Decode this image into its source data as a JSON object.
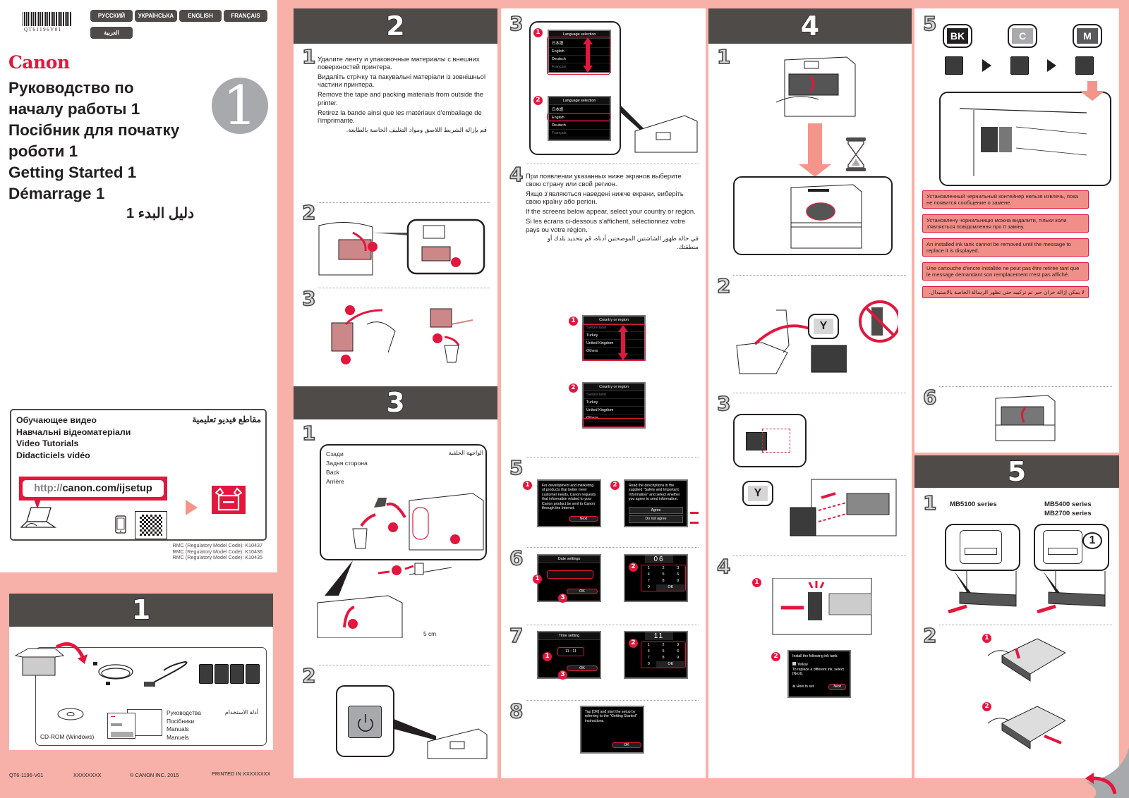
{
  "header": {
    "barcode_code": "QT61196V01",
    "languages": [
      "РУССКИЙ",
      "УКРАЇНСЬКА",
      "ENGLISH",
      "FRANÇAIS",
      "العربية"
    ],
    "brand": "Canon",
    "titles": [
      "Руководство по",
      "началу работы 1",
      "Посібник для початку",
      "роботи 1",
      "Getting Started 1",
      "Démarrage 1"
    ],
    "title_ar": "دليل البدء 1",
    "sheet_number": "1",
    "brand_color": "#e3173e",
    "accent_pink": "#f7b1a9",
    "bar_color": "#4e4b48"
  },
  "video": {
    "lines": [
      "Обучающее видео",
      "Навчальні відеоматеріали",
      "Video Tutorials",
      "Didacticiels vidéo"
    ],
    "title_ar": "مقاطع فيديو تعليمية",
    "url_prefix": "http://",
    "url_main": "canon.com/ijsetup"
  },
  "rmc": [
    "RMC (Regulatory Model Code): K10437",
    "RMC (Regulatory Model Code): K10436",
    "RMC (Regulatory Model Code): K10435"
  ],
  "section1": {
    "number": "1",
    "cdrom_label": "CD-ROM (Windows)",
    "manuals": [
      "Руководства",
      "Посібники",
      "Manuals",
      "Manuels"
    ],
    "manuals_ar": "أدلة الاستخدام"
  },
  "footer": {
    "code": "QT6-1196-V01",
    "placeholder": "XXXXXXXX",
    "copyright": "© CANON INC. 2015",
    "printed": "PRINTED IN XXXXXXXX"
  },
  "section2": {
    "number": "2",
    "step1": {
      "num": "1",
      "text": [
        "Удалите ленту и упаковочные материалы с внешних поверхностей принтера.",
        "Видаліть стрічку та пакувальні матеріали із зовнішньої частини принтера.",
        "Remove the tape and packing materials from outside the printer.",
        "Retirez la bande ainsi que les matériaux d'emballage de l'imprimante."
      ],
      "text_ar": "قم بإزالة الشريط اللاصق ومواد التغليف الخاصة بالطابعة."
    },
    "step2": {
      "num": "2"
    },
    "step3": {
      "num": "3"
    }
  },
  "section3": {
    "number": "3",
    "step1": {
      "num": "1",
      "back_labels": [
        "Сзади",
        "Задня сторона",
        "Back",
        "Arrière"
      ],
      "back_ar": "الواجهة الخلفية",
      "distance": "5 cm"
    },
    "step2": {
      "num": "2"
    },
    "step3": {
      "num": "3",
      "screen_title": "Language selection",
      "languages": [
        "日本語",
        "English",
        "Deutsch",
        "Français"
      ]
    },
    "step4": {
      "num": "4",
      "text": [
        "При появлении указанных ниже экранов выберите свою страну или свой регион.",
        "Якщо з'являються наведені нижче екрани, виберіть свою країну або регіон.",
        "If the screens below appear, select your country or region.",
        "Si les écrans ci-dessous s'affichent, sélectionnez votre pays ou votre région."
      ],
      "text_ar": "في حالة ظهور الشاشتين الموضحتين أدناه، قم بتحديد بلدك أو منطقتك.",
      "screen_title": "Country or region",
      "countries": [
        "Switzerland",
        "Turkey",
        "United Kingdom",
        "Others"
      ]
    },
    "step5": {
      "num": "5",
      "screen1_text": "For development and marketing of products that better meet customer needs, Canon requests that information related to your Canon product be sent to Canon through the Internet.",
      "screen1_button": "Next",
      "screen2_text": "Read the descriptions in the supplied \"Safety and Important Information\" and select whether you agree to send information.",
      "agree": "Agree",
      "disagree": "Do not agree"
    },
    "step6": {
      "num": "6",
      "screen_title": "Date settings",
      "ok": "OK",
      "keypad_value": "06",
      "keys": [
        "1",
        "2",
        "3",
        "4",
        "5",
        "6",
        "7",
        "8",
        "9",
        "0",
        "OK"
      ]
    },
    "step7": {
      "num": "7",
      "screen_title": "Time setting",
      "hour": "11",
      "minute": "11",
      "ok": "OK",
      "keypad_value": "11"
    },
    "step8": {
      "num": "8",
      "screen_text": "Tap [OK] and start the setup by referring to the \"Getting Started\" instructions.",
      "ok": "OK"
    }
  },
  "section4": {
    "number": "4",
    "step1": {
      "num": "1"
    },
    "step2": {
      "num": "2",
      "tank_label": "Y"
    },
    "step3": {
      "num": "3",
      "tank_label": "Y"
    },
    "step4": {
      "num": "4",
      "screen_lines": [
        "Install the following ink tank.",
        "Yellow",
        "To replace a different ink, select [Next]."
      ],
      "how_to": "How to set",
      "next": "Next"
    },
    "step5": {
      "num": "5",
      "tanks": [
        "BK",
        "C",
        "M"
      ],
      "notices": [
        "Установленный чернильный контейнер нельзя извлечь, пока не появится сообщение о замене.",
        "Установлену чорнильницю можна видалити, тільки коли з'являється повідомлення про її заміну.",
        "An installed ink tank cannot be removed until the message to replace it is displayed.",
        "Une cartouche d'encre installée ne peut pas être retirée tant que le message demandant son remplacement n'est pas affiché."
      ],
      "notice_ar": "لا يمكن إزالة خزان حبر تم تركيبه حتى تظهر الرسالة الخاصة بالاستبدال."
    },
    "step6": {
      "num": "6"
    }
  },
  "section5": {
    "number": "5",
    "step1": {
      "num": "1",
      "series_a": "MB5100 series",
      "series_b": [
        "MB5400 series",
        "MB2700 series"
      ],
      "callout_num": "1"
    },
    "step2": {
      "num": "2"
    }
  },
  "markers": [
    "1",
    "2",
    "3"
  ]
}
